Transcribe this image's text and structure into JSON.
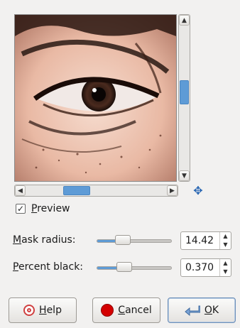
{
  "preview": {
    "checkbox_state": "checked",
    "label_mnemonic": "P",
    "label_rest": "review"
  },
  "params": {
    "mask_radius": {
      "label_mnemonic": "M",
      "label_rest": "ask radius:",
      "value": "14.42",
      "slider_fraction": 0.35
    },
    "percent_black": {
      "label_mnemonic": "P",
      "label_rest": "ercent black:",
      "value": "0.370",
      "slider_fraction": 0.37
    }
  },
  "buttons": {
    "help": {
      "mnemonic": "H",
      "rest": "elp"
    },
    "cancel": {
      "mnemonic": "C",
      "rest": "ancel"
    },
    "ok": {
      "mnemonic": "O",
      "rest": "K"
    }
  },
  "icons": {
    "scroll_up": "▲",
    "scroll_down": "▼",
    "scroll_left": "◀",
    "scroll_right": "▶",
    "navigate": "✥",
    "check": "✓",
    "spin_up": "▲",
    "spin_down": "▼"
  },
  "colors": {
    "accent": "#5e9bd6",
    "cancel_red": "#d40000"
  }
}
